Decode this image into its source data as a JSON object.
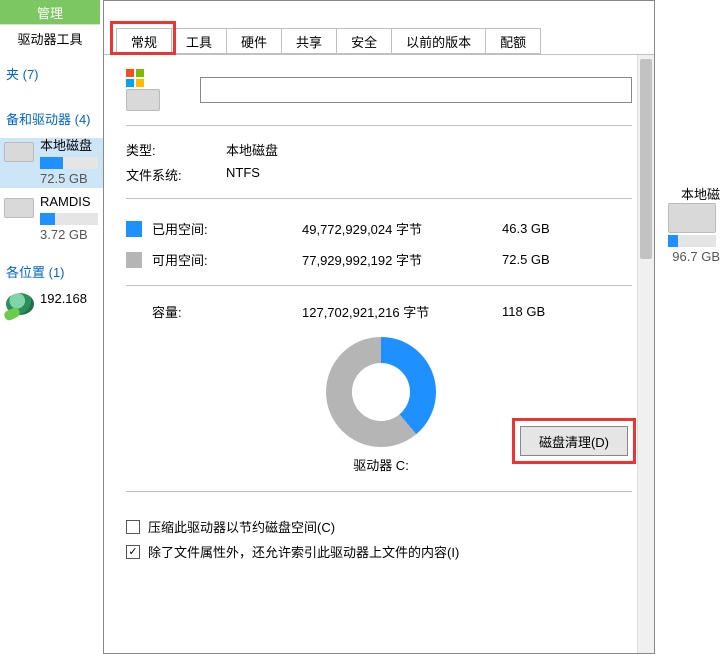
{
  "ribbon": {
    "tab1": "管理",
    "tab2": "驱动器工具"
  },
  "tree": {
    "folders": "夹 (7)",
    "devices": "备和驱动器 (4)",
    "drive1_name": "本地磁盘",
    "drive1_size": "72.5 GB",
    "drive1_fill_pct": 40,
    "drive2_name": "RAMDIS",
    "drive2_size": "3.72 GB",
    "drive2_fill_pct": 25,
    "net_loc": "各位置 (1)",
    "net_ip": "192.168"
  },
  "right": {
    "name": "本地磁",
    "size": "96.7 GB",
    "fill_pct": 20
  },
  "tabs": [
    "常规",
    "工具",
    "硬件",
    "共享",
    "安全",
    "以前的版本",
    "配额"
  ],
  "active_tab": "常规",
  "general": {
    "type_label": "类型:",
    "type_value": "本地磁盘",
    "fs_label": "文件系统:",
    "fs_value": "NTFS",
    "used_label": "已用空间:",
    "used_bytes": "49,772,929,024 字节",
    "used_gb": "46.3 GB",
    "free_label": "可用空间:",
    "free_bytes": "77,929,992,192 字节",
    "free_gb": "72.5 GB",
    "cap_label": "容量:",
    "cap_bytes": "127,702,921,216 字节",
    "cap_gb": "118 GB",
    "drive_letter": "驱动器 C:",
    "cleanup_btn": "磁盘清理(D)",
    "chk_compress": "压缩此驱动器以节约磁盘空间(C)",
    "chk_index": "除了文件属性外，还允许索引此驱动器上文件的内容(I)",
    "chk_index_state": true,
    "chk_compress_state": false
  },
  "chart_data": {
    "type": "pie",
    "title": "驱动器 C:",
    "series": [
      {
        "name": "已用空间",
        "value_bytes": 49772929024,
        "value_gb": 46.3,
        "color": "#1e90ff"
      },
      {
        "name": "可用空间",
        "value_bytes": 77929992192,
        "value_gb": 72.5,
        "color": "#b5b5b5"
      }
    ],
    "total_bytes": 127702921216,
    "total_gb": 118
  }
}
